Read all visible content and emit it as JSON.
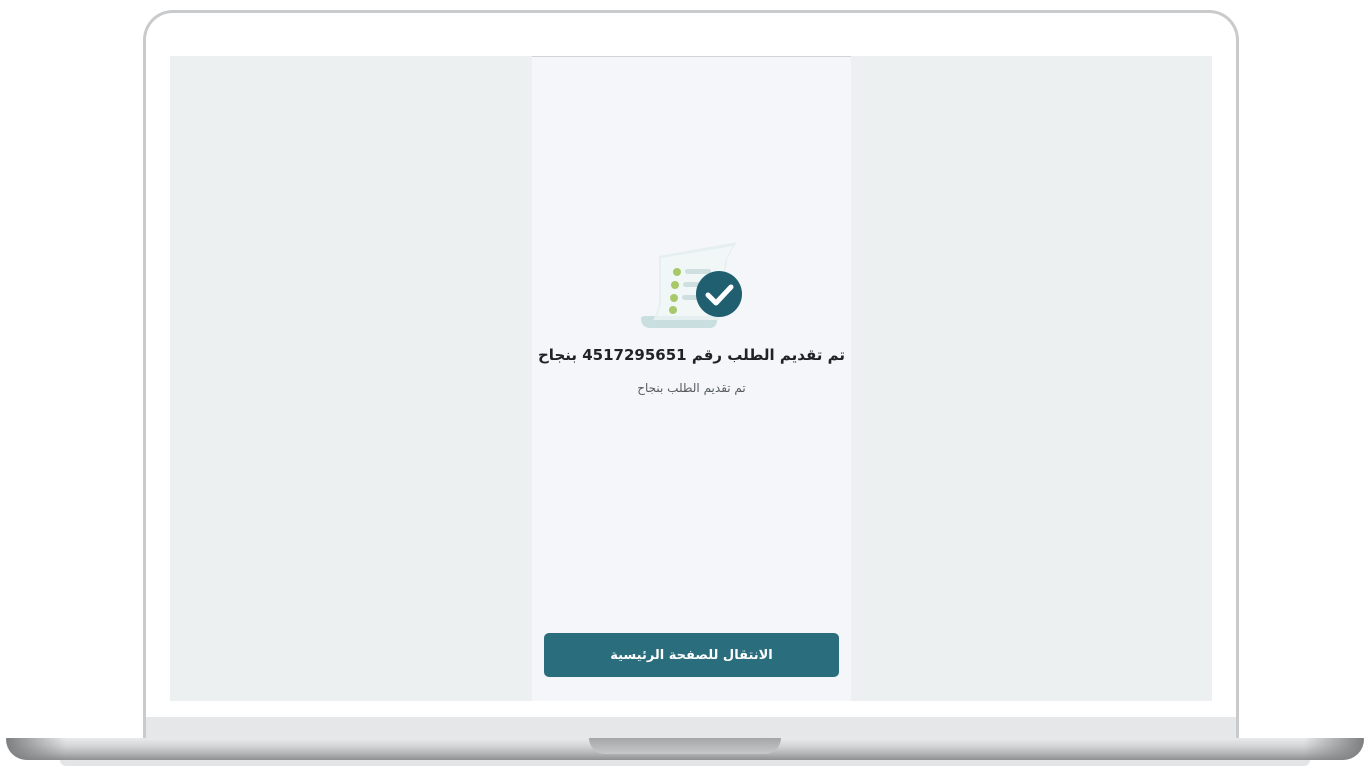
{
  "confirmation": {
    "title": "تم تقديم الطلب رقم 4517295651 بنجاح",
    "subtitle": "تم تقديم الطلب بنجاح",
    "illustration_icon": "receipt-check-icon"
  },
  "actions": {
    "home_button_label": "الانتقال للصفحة الرئيسية"
  },
  "colors": {
    "primary": "#2a6e7d",
    "check_badge": "#1f5f6f",
    "screen_background": "#ecf0f1",
    "phone_background": "#f4f6f9",
    "title_text": "#1f2328",
    "subtitle_text": "#555b61"
  }
}
